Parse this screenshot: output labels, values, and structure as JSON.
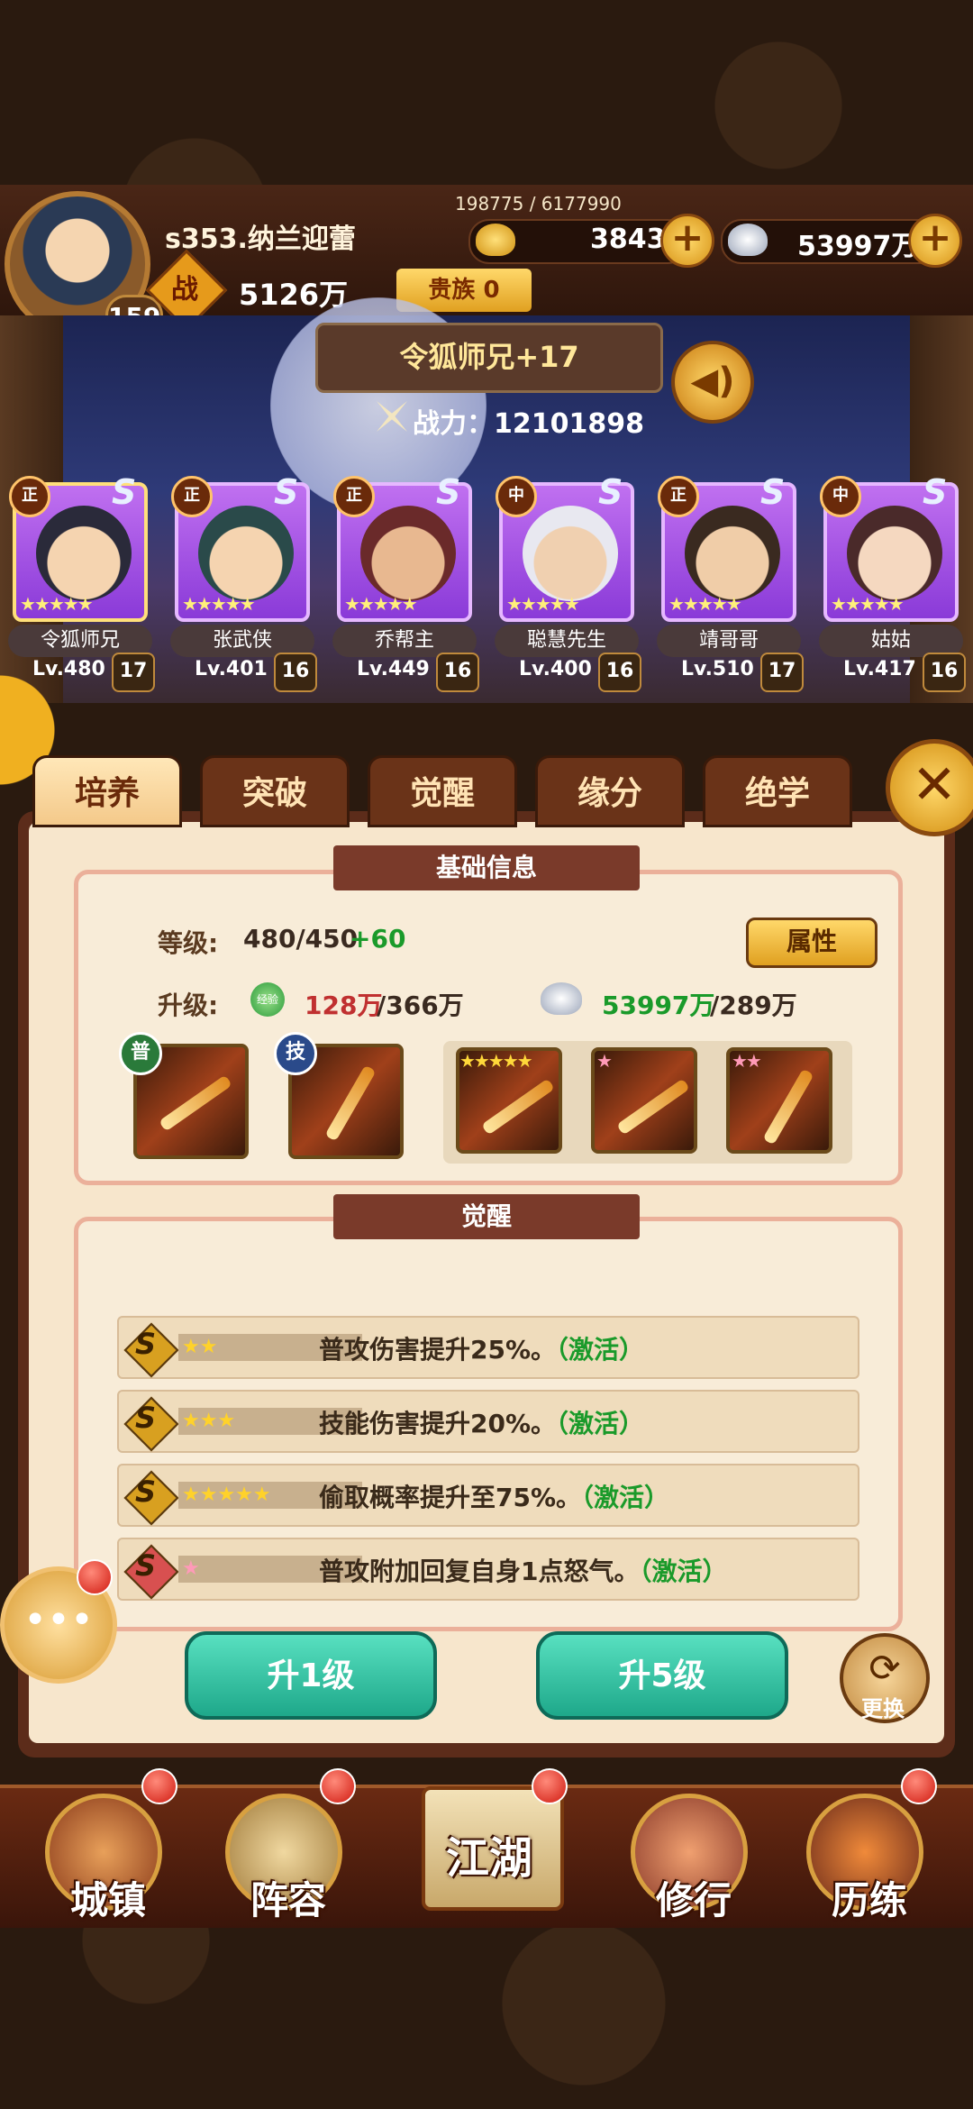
{
  "player": {
    "exp": "198775 / 6177990",
    "name": "s353.纳兰迎蕾",
    "level": "159",
    "gold": "3843",
    "silver": "53997万",
    "power_icon": "战",
    "power": "5126万",
    "vip": "贵族 0"
  },
  "hero_display": {
    "name": "令狐师兄+17",
    "combat_power": "战力：12101898"
  },
  "heroes": [
    {
      "role": "正",
      "grade": "S",
      "name": "令狐师兄",
      "level": "Lv.480",
      "adv": "17"
    },
    {
      "role": "正",
      "grade": "S",
      "name": "张武侠",
      "level": "Lv.401",
      "adv": "16"
    },
    {
      "role": "正",
      "grade": "S",
      "name": "乔帮主",
      "level": "Lv.449",
      "adv": "16"
    },
    {
      "role": "中",
      "grade": "S",
      "name": "聪慧先生",
      "level": "Lv.400",
      "adv": "16"
    },
    {
      "role": "正",
      "grade": "S",
      "name": "靖哥哥",
      "level": "Lv.510",
      "adv": "17"
    },
    {
      "role": "中",
      "grade": "S",
      "name": "姑姑",
      "level": "Lv.417",
      "adv": "16"
    }
  ],
  "tabs": [
    "培养",
    "突破",
    "觉醒",
    "缘分",
    "绝学"
  ],
  "basic": {
    "title": "基础信息",
    "level_label": "等级:",
    "level_value": "480/450",
    "level_bonus": "+60",
    "attr_button": "属性",
    "upgrade_label": "升级:",
    "exp_icon": "经验",
    "exp_have": "128万",
    "exp_need": "/366万",
    "silver_have": "53997万",
    "silver_need": "/289万",
    "badge_normal": "普",
    "badge_skill": "技"
  },
  "awaken": {
    "title": "觉醒",
    "rows": [
      {
        "stars": "★★",
        "text": "普攻伤害提升25%。",
        "status": "（激活）"
      },
      {
        "stars": "★★★",
        "text": "技能伤害提升20%。",
        "status": "（激活）"
      },
      {
        "stars": "★★★★★",
        "text": "偷取概率提升至75%。",
        "status": "（激活）"
      },
      {
        "stars": "★",
        "text": "普攻附加回复自身1点怒气。",
        "status": "（激活）"
      }
    ]
  },
  "actions": {
    "up1": "升1级",
    "up5": "升5级",
    "change": "更换"
  },
  "nav": [
    "城镇",
    "阵容",
    "江湖",
    "修行",
    "历练"
  ]
}
